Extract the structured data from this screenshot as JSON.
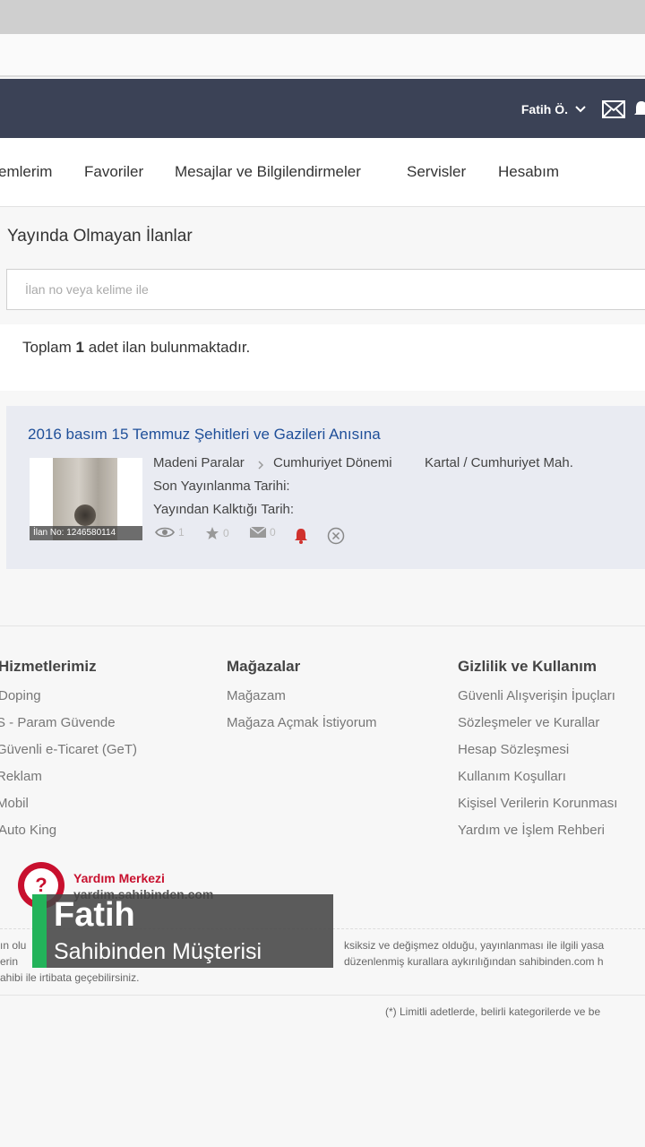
{
  "header": {
    "user_name": "Fatih Ö.",
    "accent_color": "#3b4256"
  },
  "tabs": [
    {
      "label": "emlerim"
    },
    {
      "label": "Favoriler"
    },
    {
      "label": "Mesajlar ve Bilgilendirmeler"
    },
    {
      "label": "Servisler"
    },
    {
      "label": "Hesabım"
    }
  ],
  "page": {
    "section_title": "Yayında Olmayan İlanlar",
    "search_placeholder": "İlan no veya kelime ile",
    "total_prefix": "Toplam",
    "total_count": "1",
    "total_suffix": "adet ilan bulunmaktadır."
  },
  "listing": {
    "title": "2016 basım 15 Temmuz Şehitleri ve Gazileri Anısına",
    "ilan_no": "İlan No: 1246580114",
    "category_1": "Madeni Paralar",
    "category_2": "Cumhuriyet Dönemi",
    "location": "Kartal / Cumhuriyet Mah.",
    "last_published_label": "Son Yayınlanma Tarihi:",
    "removed_label": "Yayından Kalktığı Tarih:",
    "views": "1",
    "favorites": "0",
    "messages": "0",
    "alert_color": "#d0312d",
    "link_color": "#1f4f99"
  },
  "footer": {
    "col1_title": "Hizmetlerimiz",
    "col1_links": [
      "Doping",
      "S - Param Güvende",
      "Güvenli e-Ticaret (GeT)",
      "Reklam",
      "Mobil",
      "Auto King"
    ],
    "col2_title": "Mağazalar",
    "col2_links": [
      "Mağazam",
      "Mağaza Açmak İstiyorum"
    ],
    "col3_title": "Gizlilik ve Kullanım",
    "col3_links": [
      "Güvenli Alışverişin İpuçları",
      "Sözleşmeler ve Kurallar",
      "Hesap Sözleşmesi",
      "Kullanım Koşulları",
      "Kişisel Verilerin Korunması",
      "Yardım ve İşlem Rehberi"
    ],
    "help_title": "Yardım Merkezi",
    "help_url": "yardim.sahibinden.com",
    "fine_1a": "ın olu",
    "fine_1b": "ksiksiz ve değişmez olduğu, yayınlanması ile ilgili yasa",
    "fine_2a": "erin",
    "fine_2b": "düzenlenmiş kurallara aykırılığından sahibinden.com h",
    "fine_3": "ahibi ile irtibata geçebilirsiniz.",
    "fine_4": "(*) Limitli adetlerde, belirli kategorilerde ve be",
    "brand_red": "#c8102e"
  },
  "caption": {
    "name": "Fatih",
    "role": "Sahibinden Müşterisi",
    "accent": "#23b35a"
  }
}
